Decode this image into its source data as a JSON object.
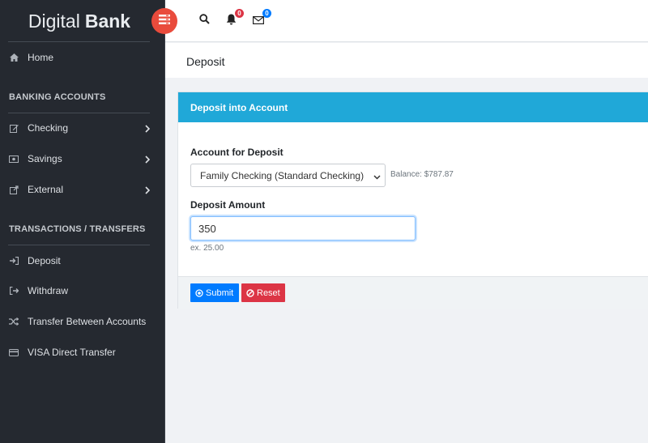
{
  "brand": {
    "light": "Digital",
    "bold": "Bank"
  },
  "sidebar": {
    "home": "Home",
    "banking_header": "BANKING ACCOUNTS",
    "checking": "Checking",
    "savings": "Savings",
    "external": "External",
    "transactions_header": "TRANSACTIONS / TRANSFERS",
    "deposit": "Deposit",
    "withdraw": "Withdraw",
    "transfer": "Transfer Between Accounts",
    "visa": "VISA Direct Transfer"
  },
  "topbar": {
    "notifications_count": "0",
    "messages_count": "0"
  },
  "page": {
    "title": "Deposit"
  },
  "form": {
    "card_title": "Deposit into Account",
    "account_label": "Account for Deposit",
    "account_selected": "Family Checking (Standard Checking)",
    "balance": "Balance: $787.87",
    "amount_label": "Deposit Amount",
    "amount_value": "350",
    "amount_hint": "ex. 25.00",
    "submit_label": "Submit",
    "reset_label": "Reset"
  },
  "colors": {
    "sidebar_bg": "#252930",
    "card_header": "#20a8d8",
    "submit": "#007bff",
    "reset": "#dc3545",
    "menu_button": "#e94b3c"
  }
}
